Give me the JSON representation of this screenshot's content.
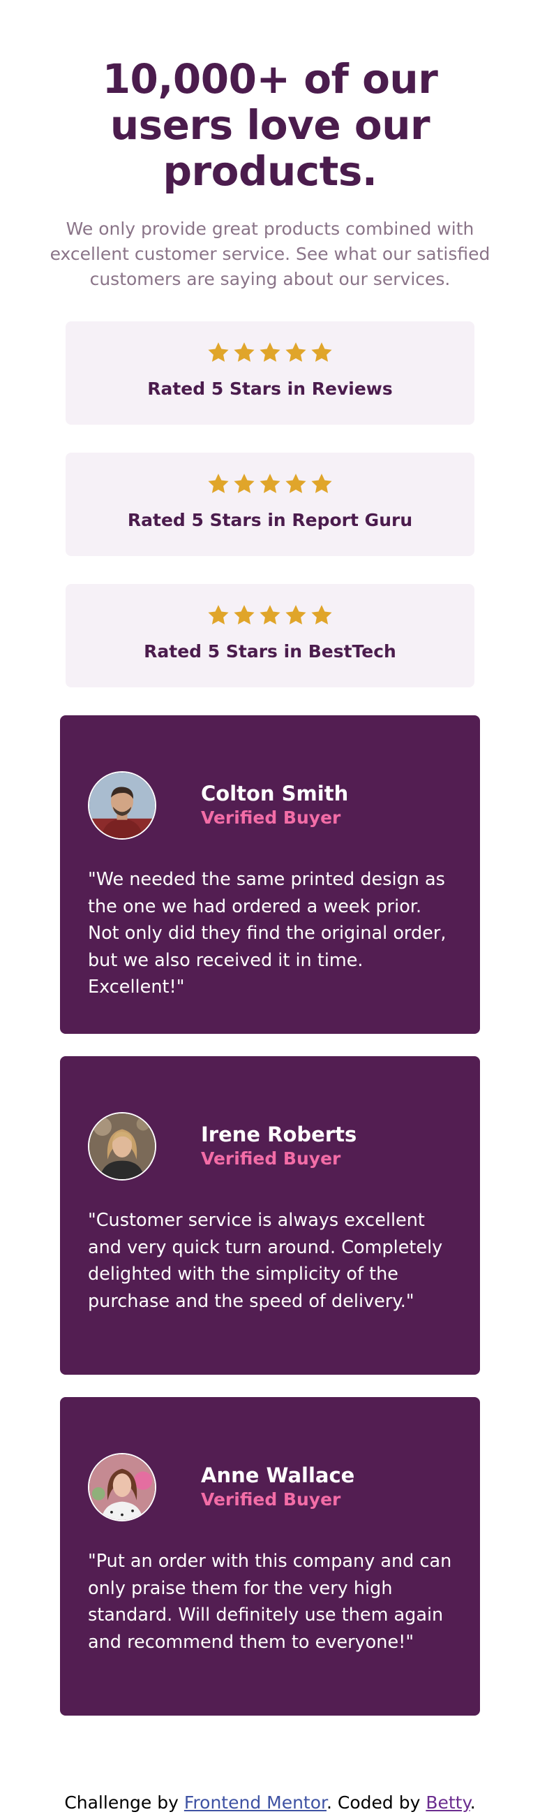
{
  "hero": {
    "title": "10,000+ of our users love our products.",
    "description": "We only provide great products combined with excellent customer service. See what our satisfied customers are saying about our services."
  },
  "ratings": [
    {
      "stars": 5,
      "label": "Rated 5 Stars in Reviews"
    },
    {
      "stars": 5,
      "label": "Rated 5 Stars in Report Guru"
    },
    {
      "stars": 5,
      "label": "Rated 5 Stars in BestTech"
    }
  ],
  "testimonials": [
    {
      "name": "Colton Smith",
      "status": "Verified Buyer",
      "quote": "\"We needed the same printed design as the one we had ordered a week prior. Not only did they find the original order, but we also received it in time. Excellent!\""
    },
    {
      "name": "Irene Roberts",
      "status": "Verified Buyer",
      "quote": "\"Customer service is always excellent and very quick turn around. Completely delighted with the simplicity of the purchase and the speed of delivery.\""
    },
    {
      "name": "Anne Wallace",
      "status": "Verified Buyer",
      "quote": "\"Put an order with this company and can only praise them for the very high standard. Will definitely use them again and recommend them to everyone!\""
    }
  ],
  "attribution": {
    "prefix": "Challenge by ",
    "link1": "Frontend Mentor",
    "middle": ". Coded by ",
    "link2": "Betty",
    "suffix": "."
  },
  "colors": {
    "primary": "#4b1c4d",
    "card": "#531e52",
    "accent": "#f36da7",
    "star": "#e0a52a",
    "rating_bg": "#f6f1f7"
  }
}
